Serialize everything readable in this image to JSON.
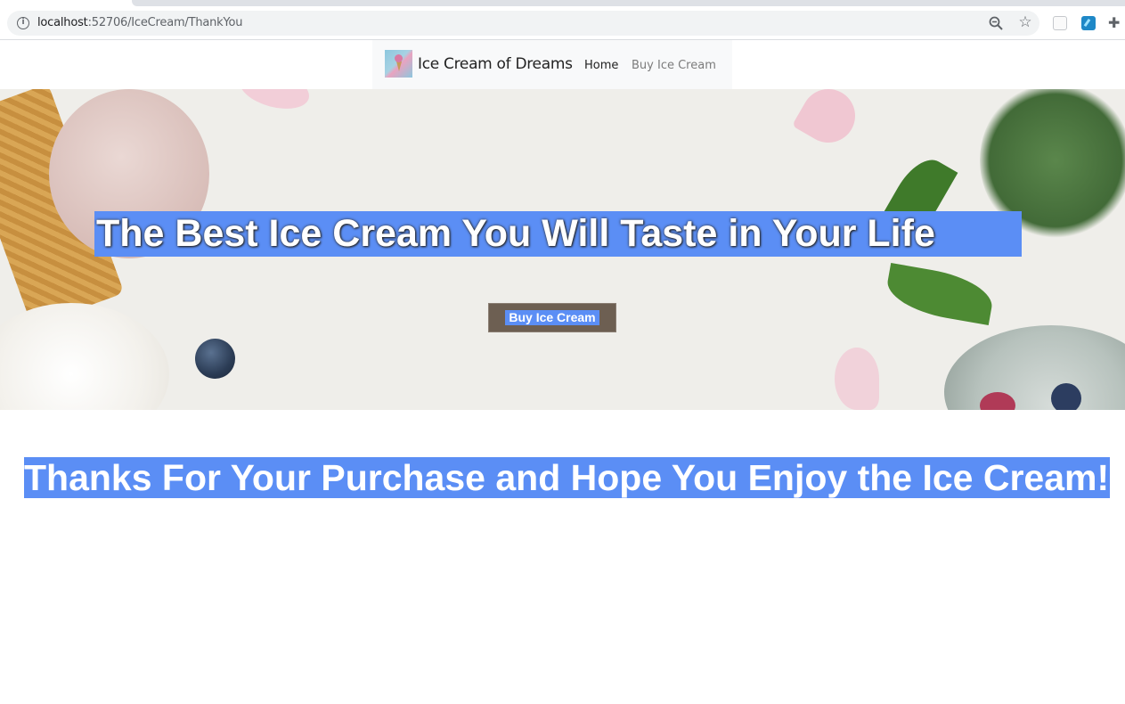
{
  "browser": {
    "url_host": "localhost",
    "url_path": ":52706/IceCream/ThankYou",
    "icons": [
      "info-icon",
      "zoom-icon",
      "star-icon",
      "extension-icon",
      "extension-icon",
      "puzzle-icon"
    ]
  },
  "navbar": {
    "brand": "Ice Cream of Dreams",
    "links": [
      {
        "label": "Home"
      },
      {
        "label": "Buy Ice Cream"
      }
    ]
  },
  "hero": {
    "title": "The Best Ice Cream You Will Taste in Your Life",
    "button": "Buy Ice Cream"
  },
  "main": {
    "message": "Thanks For Your Purchase and Hope You Enjoy the Ice Cream!"
  },
  "colors": {
    "selection": "#5b8ef5",
    "button_bg": "#6d5f52",
    "navbar_bg": "#f8f9fa"
  }
}
